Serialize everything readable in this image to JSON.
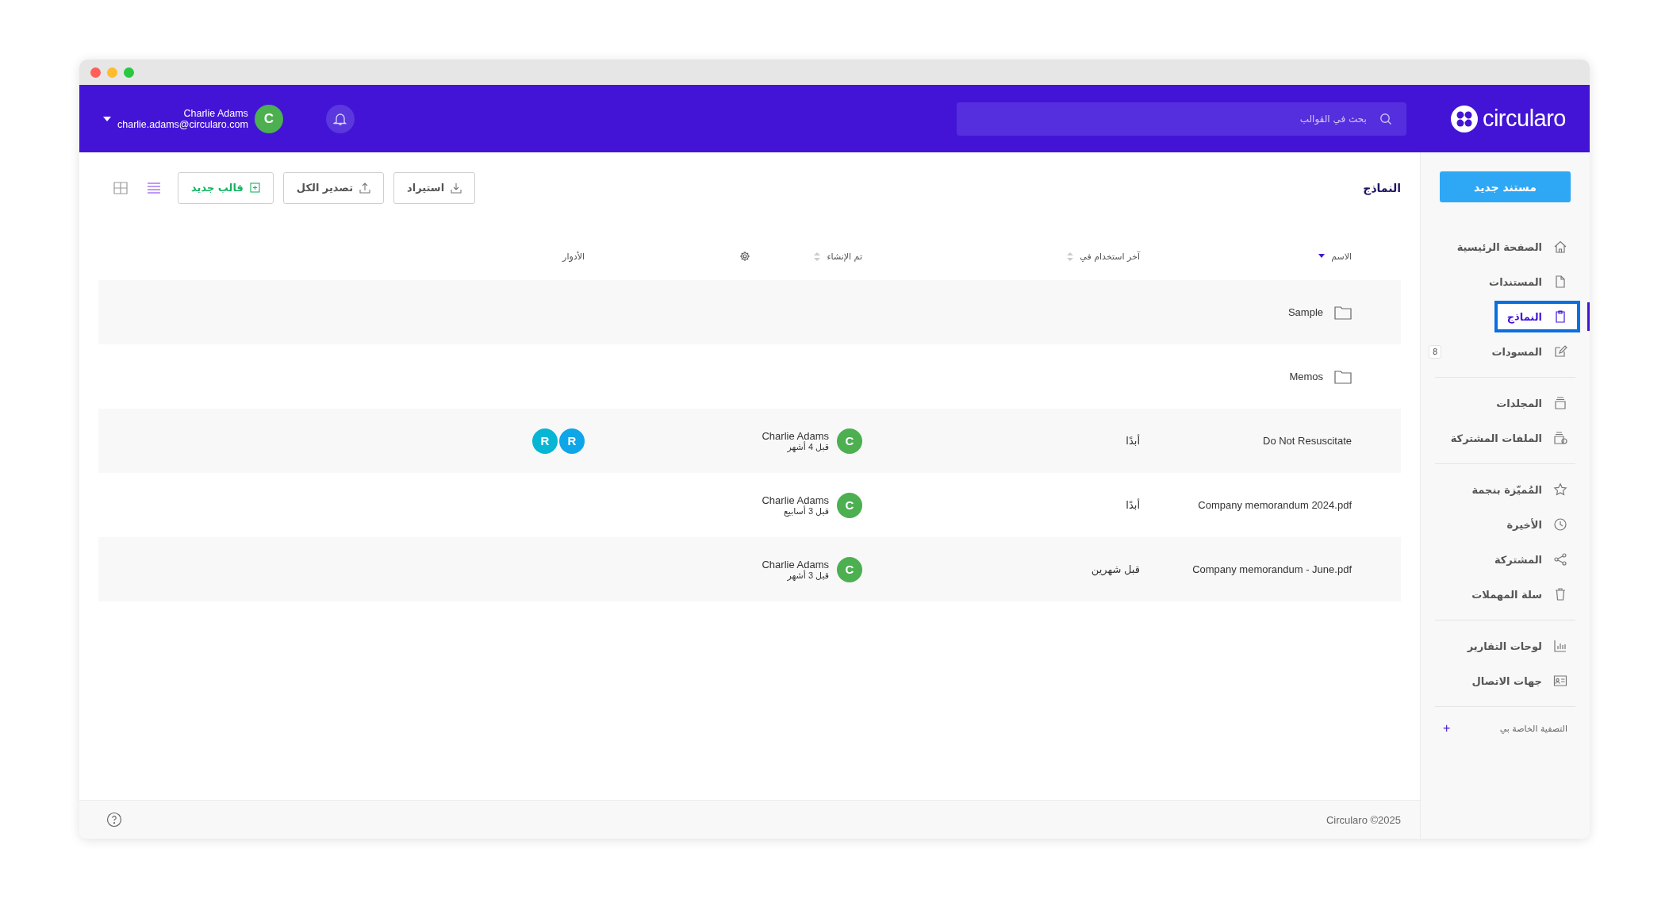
{
  "header": {
    "logo": "circularo",
    "search": {
      "placeholder": "بحث في القوالب"
    },
    "user": {
      "name": "Charlie Adams",
      "email": "charlie.adams@circularo.com",
      "initial": "C"
    }
  },
  "sidebar": {
    "new_button": "مستند جديد",
    "groups": [
      [
        {
          "label": "الصفحة الرئيسية",
          "selected": false
        },
        {
          "label": "المستندات",
          "selected": false
        },
        {
          "label": "النماذج",
          "selected": true
        },
        {
          "label": "المسودات",
          "selected": false,
          "badge": "8"
        }
      ],
      [
        {
          "label": "المجلدات",
          "selected": false
        },
        {
          "label": "الملفات المشتركة",
          "selected": false
        }
      ],
      [
        {
          "label": "المُميّزة بنجمة",
          "selected": false
        },
        {
          "label": "الأخيرة",
          "selected": false
        },
        {
          "label": "المشتركة",
          "selected": false
        },
        {
          "label": "سلة المهملات",
          "selected": false
        }
      ],
      [
        {
          "label": "لوحات التقارير",
          "selected": false
        },
        {
          "label": "جهات الاتصال",
          "selected": false
        }
      ]
    ],
    "filters": {
      "label": "التصفية الخاصة بي",
      "add": "+"
    }
  },
  "page_title": "النماذج",
  "toolbar": {
    "buttons": [
      {
        "label": "استيراد",
        "kind": "import"
      },
      {
        "label": "تصدير الكل",
        "kind": "export"
      },
      {
        "label": "قالب جديد",
        "kind": "new"
      }
    ],
    "views": [
      {
        "kind": "list",
        "selected": true
      },
      {
        "kind": "grid",
        "selected": false
      }
    ]
  },
  "table": {
    "columns": [
      {
        "label": "الاسم",
        "kind": "sortable",
        "sorted": true
      },
      {
        "label": "آخر استخدام في",
        "kind": "sortable",
        "sorted": false
      },
      {
        "label": "تم الإنشاء",
        "kind": "sortable",
        "sorted": false
      },
      {
        "kind": "settings"
      },
      {
        "label": "الأدوار",
        "kind": "plain"
      }
    ],
    "rows": [
      {
        "kind": "folder",
        "name": "Sample"
      },
      {
        "kind": "folder",
        "name": "Memos"
      },
      {
        "kind": "document",
        "name": "Do Not Resuscitate",
        "last_used": "أبدًا",
        "creator": {
          "initial": "C",
          "name": "Charlie Adams",
          "time": "قبل 4 أشهر"
        },
        "roles": [
          {
            "initial": "R",
            "color": "#0ea5e9"
          },
          {
            "initial": "R",
            "color": "#06b6d4"
          }
        ]
      },
      {
        "kind": "document",
        "name": "Company memorandum 2024.pdf",
        "last_used": "أبدًا",
        "creator": {
          "initial": "C",
          "name": "Charlie Adams",
          "time": "قبل 3 أسابيع"
        }
      },
      {
        "kind": "document",
        "name": "Company memorandum - June.pdf",
        "last_used": "قبل شهرين",
        "creator": {
          "initial": "C",
          "name": "Charlie Adams",
          "time": "قبل 3 أشهر"
        }
      }
    ]
  },
  "footer": {
    "copyright": "Circularo ©2025"
  }
}
